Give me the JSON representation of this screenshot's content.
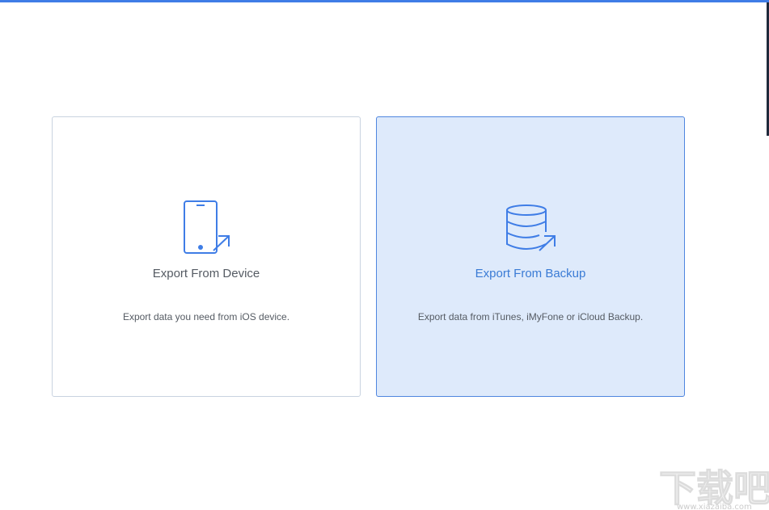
{
  "options": [
    {
      "title": "Export From Device",
      "description": "Export data you need from iOS device.",
      "icon": "phone-export-icon"
    },
    {
      "title": "Export From Backup",
      "description": "Export data from iTunes, iMyFone or iCloud Backup.",
      "icon": "database-export-icon",
      "selected": true
    }
  ],
  "watermark": {
    "text": "下载吧",
    "url": "www.xiazaiba.com"
  },
  "colors": {
    "accent": "#3f7de6",
    "selected_bg": "#deeafb",
    "text": "#555b63"
  }
}
